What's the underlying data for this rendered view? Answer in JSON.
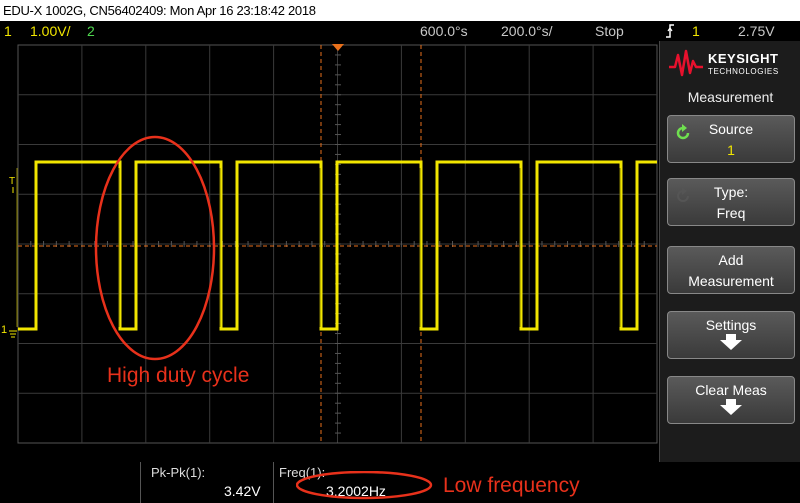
{
  "title_bar": {
    "text": "EDU-X 1002G, CN56402409: Mon Apr 16 23:18:42 2018"
  },
  "status_bar": {
    "channel1_number": "1",
    "channel1_scale": "1.00V/",
    "channel2_number": "2",
    "time_scale": "600.0°s",
    "time_delay": "200.0°s/",
    "run_state": "Stop",
    "trigger_slope_icon": "rising-edge-icon",
    "trigger_source": "1",
    "trigger_level": "2.75V"
  },
  "colors": {
    "channel1": "#f2e600",
    "channel2": "#4fd64f",
    "annotation": "#e8311b",
    "cursor": "#e8701b"
  },
  "side_panel": {
    "brand": "KEYSIGHT",
    "brand_sub": "TECHNOLOGIES",
    "menu_title": "Measurement",
    "softkeys": [
      {
        "label": "Source",
        "value": "1",
        "icon": "cycle-icon"
      },
      {
        "label": "Type:",
        "value": "Freq",
        "icon": "cycle-icon"
      },
      {
        "label": "Add",
        "value": "Measurement"
      },
      {
        "label": "Settings",
        "icon": "down-arrow-icon"
      },
      {
        "label": "Clear Meas",
        "icon": "down-arrow-icon"
      }
    ]
  },
  "graticule_markers": {
    "trigger_level_marker": "T",
    "channel1_ground_marker": "1"
  },
  "measurements": [
    {
      "label": "Pk-Pk(1):",
      "value": "3.42V"
    },
    {
      "label": "Freq(1):",
      "value": "3.2002Hz"
    }
  ],
  "waveform": {
    "channel": "1",
    "levels_volts": {
      "high": 3.42,
      "low": 0.0
    },
    "duty_cycle_description": "high duty cycle, short low pulses"
  },
  "annotations": {
    "duty_cycle_note": "High duty cycle",
    "frequency_note": "Low frequency"
  }
}
